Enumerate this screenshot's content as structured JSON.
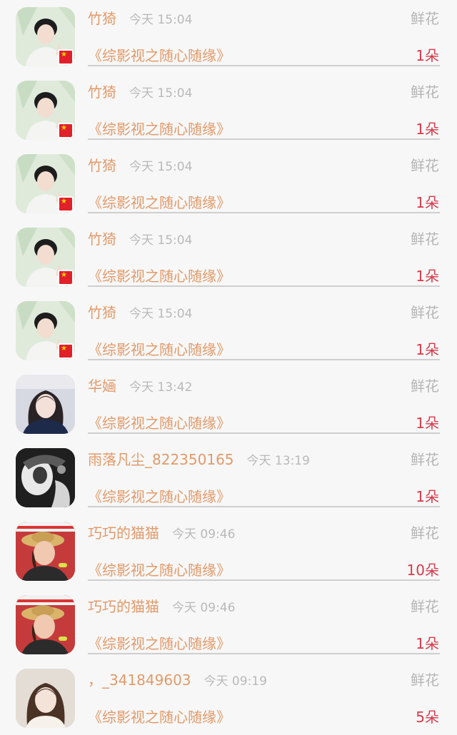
{
  "items": [
    {
      "name": "竹猗",
      "time": "今天 15:04",
      "type": "鲜花",
      "book": "《综影视之随心随缘》",
      "count": "1朵",
      "avatar": "man-portrait-icon",
      "badge": "china-flag-icon"
    },
    {
      "name": "竹猗",
      "time": "今天 15:04",
      "type": "鲜花",
      "book": "《综影视之随心随缘》",
      "count": "1朵",
      "avatar": "man-portrait-icon",
      "badge": "china-flag-icon"
    },
    {
      "name": "竹猗",
      "time": "今天 15:04",
      "type": "鲜花",
      "book": "《综影视之随心随缘》",
      "count": "1朵",
      "avatar": "man-portrait-icon",
      "badge": "china-flag-icon"
    },
    {
      "name": "竹猗",
      "time": "今天 15:04",
      "type": "鲜花",
      "book": "《综影视之随心随缘》",
      "count": "1朵",
      "avatar": "man-portrait-icon",
      "badge": "china-flag-icon"
    },
    {
      "name": "竹猗",
      "time": "今天 15:04",
      "type": "鲜花",
      "book": "《综影视之随心随缘》",
      "count": "1朵",
      "avatar": "man-portrait-icon",
      "badge": "china-flag-icon"
    },
    {
      "name": "华婳",
      "time": "今天 13:42",
      "type": "鲜花",
      "book": "《综影视之随心随缘》",
      "count": "1朵",
      "avatar": "woman-portrait-icon"
    },
    {
      "name": "雨落凡尘_822350165",
      "time": "今天 13:19",
      "type": "鲜花",
      "book": "《综影视之随心随缘》",
      "count": "1朵",
      "avatar": "monochrome-art-icon"
    },
    {
      "name": "巧巧的猫猫",
      "time": "今天 09:46",
      "type": "鲜花",
      "book": "《综影视之随心随缘》",
      "count": "10朵",
      "avatar": "woman-straw-hat-icon"
    },
    {
      "name": "巧巧的猫猫",
      "time": "今天 09:46",
      "type": "鲜花",
      "book": "《综影视之随心随缘》",
      "count": "1朵",
      "avatar": "woman-straw-hat-icon"
    },
    {
      "name": "，_341849603",
      "time": "今天 09:19",
      "type": "鲜花",
      "book": "《综影视之随心随缘》",
      "count": "5朵",
      "avatar": "woman-portrait-icon"
    }
  ]
}
